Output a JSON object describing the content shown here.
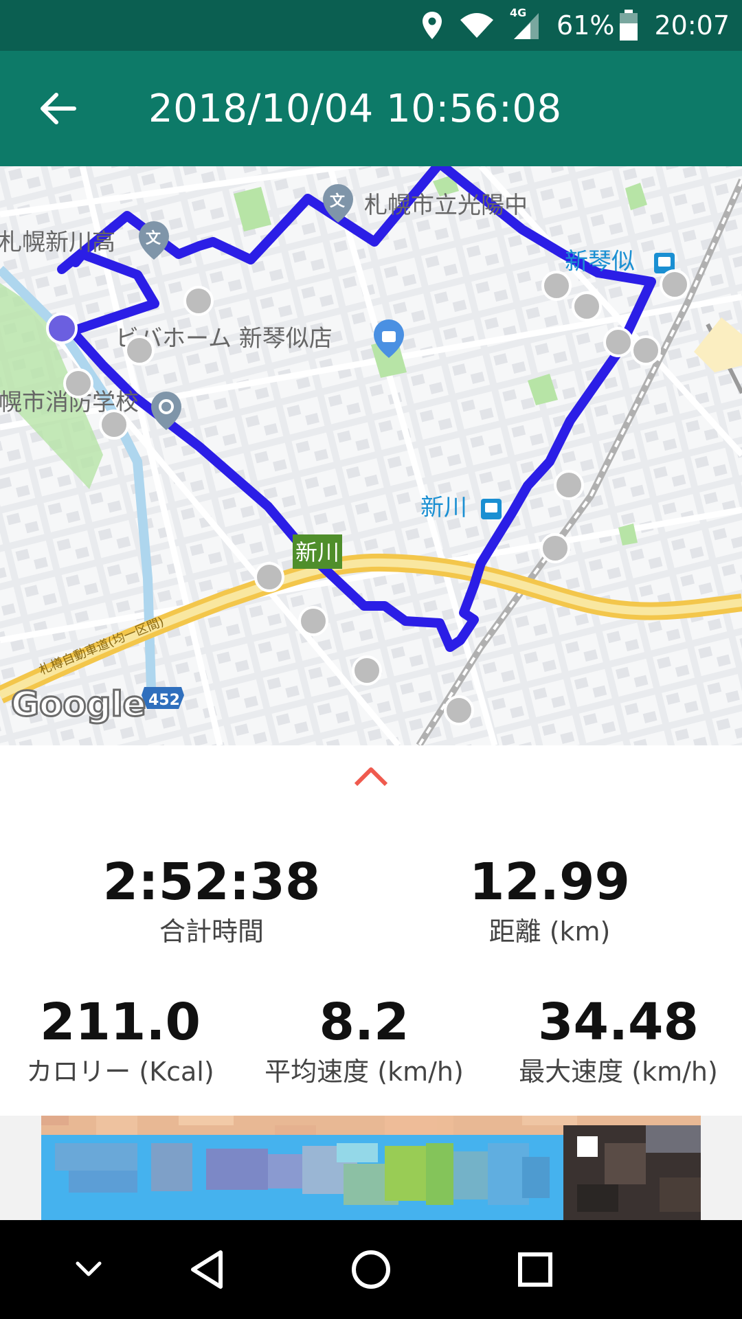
{
  "status_bar": {
    "network": "4G",
    "battery": "61%",
    "time": "20:07",
    "icons": [
      "location-icon",
      "wifi-icon",
      "signal-icon",
      "battery-icon"
    ]
  },
  "app_bar": {
    "title": "2018/10/04 10:56:08",
    "back_icon": "arrow-back-icon"
  },
  "map": {
    "labels": {
      "school_koyo": "札幌市立光陽中",
      "school_shinkawa": "札幌新川高",
      "store": "ビバホーム 新琴似店",
      "fire_school": "幌市消防学校",
      "station_shinkotoni": "新琴似",
      "station_shinkawa": "新川",
      "interchange": "新川",
      "expressway": "札樽自動車道(均一区間)",
      "route": "452",
      "attribution": "Google"
    },
    "route_color": "#2b1ee6",
    "marker_color": "#bdbdbd"
  },
  "expand_icon": "chevron-up-icon",
  "stats": {
    "total_time": {
      "value": "2:52:38",
      "label": "合計時間"
    },
    "distance": {
      "value": "12.99",
      "label": "距離 (km)"
    },
    "calories": {
      "value": "211.0",
      "label": "カロリー (Kcal)"
    },
    "avg_speed": {
      "value": "8.2",
      "label": "平均速度 (km/h)"
    },
    "max_speed": {
      "value": "34.48",
      "label": "最大速度 (km/h)"
    }
  },
  "nav_bar": {
    "icons": [
      "chevron-down-icon",
      "back-triangle-icon",
      "home-circle-icon",
      "recents-square-icon"
    ]
  }
}
